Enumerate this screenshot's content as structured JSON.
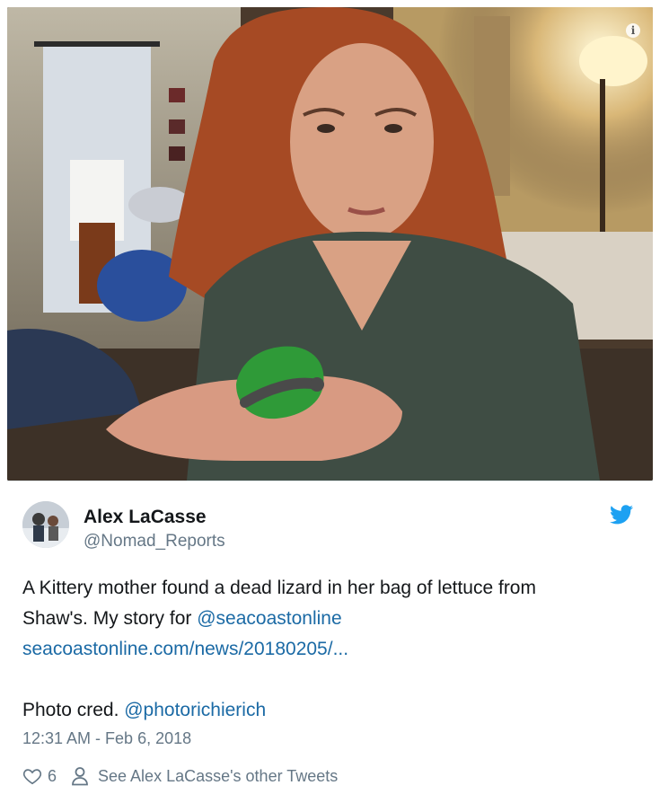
{
  "tweet": {
    "author_name": "Alex LaCasse",
    "author_handle": "@Nomad_Reports",
    "line1": "A Kittery mother found a dead lizard in her bag of lettuce from",
    "line2_prefix": "Shaw's. My story for ",
    "mention1": "@seacoastonline",
    "url": "seacoastonline.com/news/20180205/...",
    "credit_prefix": "Photo cred. ",
    "mention2": "@photorichierich",
    "timestamp": "12:31 AM - Feb 6, 2018",
    "like_count": "6",
    "other_tweets_label": "See Alex LaCasse's other Tweets"
  },
  "colors": {
    "link": "#1b6aa5",
    "twitter_blue": "#1da1f2",
    "muted": "#657786"
  },
  "icons": {
    "info": "info-icon",
    "bird": "twitter-bird-icon",
    "heart": "heart-icon",
    "person": "person-icon"
  },
  "info_icon_glyph": "i"
}
